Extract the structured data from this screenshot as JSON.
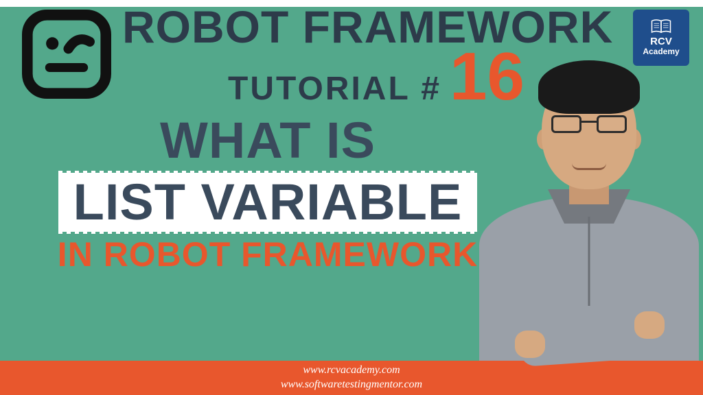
{
  "title": {
    "line1": "ROBOT FRAMEWORK",
    "line2_prefix": "TUTORIAL #",
    "number": "16"
  },
  "subtitle": {
    "line1": "WHAT IS",
    "line2": "LIST VARIABLE",
    "line3": "IN ROBOT FRAMEWORK"
  },
  "badge": {
    "line1": "RCV",
    "line2": "Academy"
  },
  "footer": {
    "url1": "www.rcvacademy.com",
    "url2": "www.softwaretestingmentor.com"
  },
  "colors": {
    "bg": "#53a88b",
    "accent": "#e8572d",
    "dark": "#2d3b4a",
    "badge": "#1f4e8c"
  }
}
